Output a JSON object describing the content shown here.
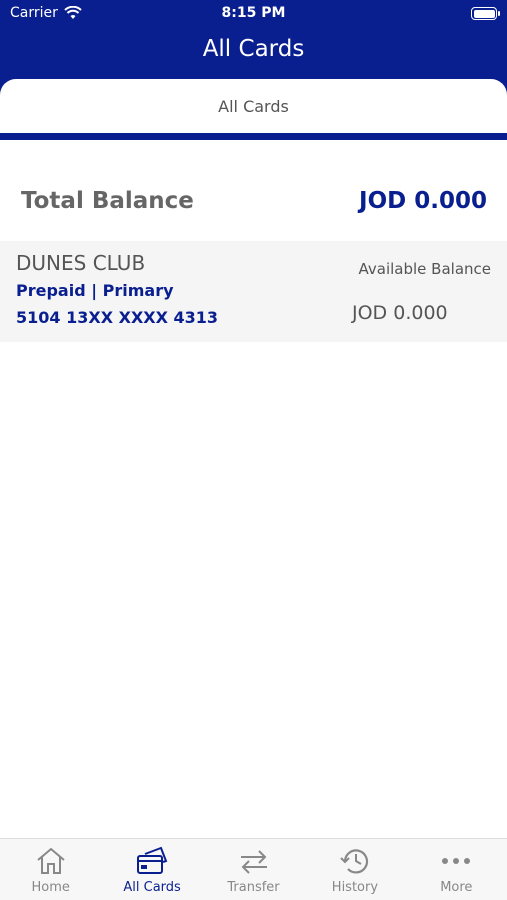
{
  "status": {
    "carrier": "Carrier",
    "time": "8:15 PM"
  },
  "header": {
    "title": "All Cards",
    "segment": "All Cards"
  },
  "summary": {
    "label": "Total Balance",
    "value": "JOD 0.000"
  },
  "card": {
    "name": "DUNES CLUB",
    "type": "Prepaid | Primary",
    "number": "5104 13XX XXXX 4313",
    "balance_label": "Available Balance",
    "balance_value": "JOD 0.000"
  },
  "tabs": [
    {
      "label": "Home",
      "icon": "home-icon"
    },
    {
      "label": "All Cards",
      "icon": "cards-icon"
    },
    {
      "label": "Transfer",
      "icon": "transfer-icon"
    },
    {
      "label": "History",
      "icon": "history-icon"
    },
    {
      "label": "More",
      "icon": "more-icon"
    }
  ],
  "colors": {
    "brand": "#0a1f8f",
    "muted": "#888888"
  }
}
